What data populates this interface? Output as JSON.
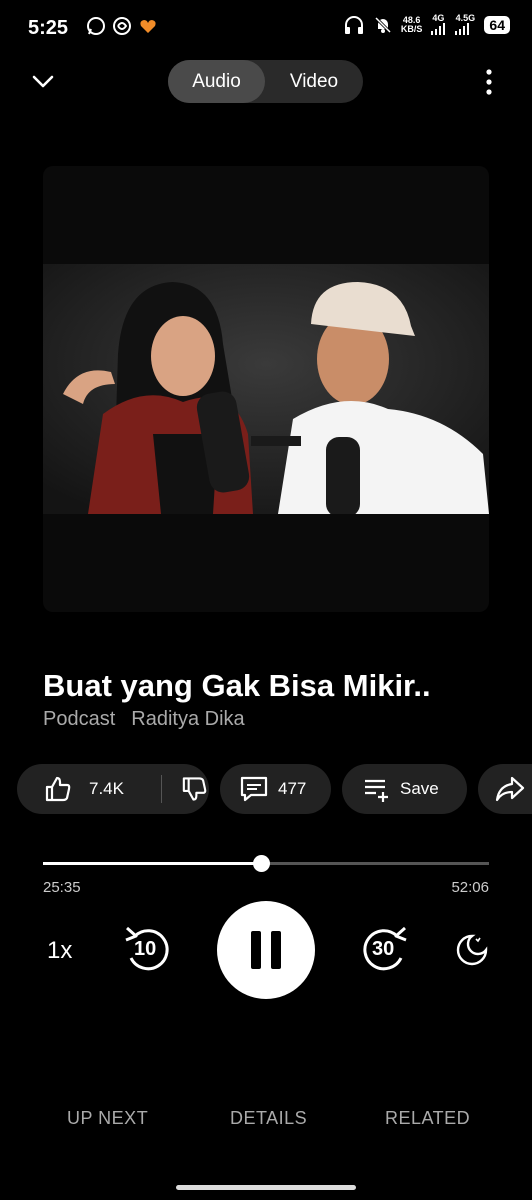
{
  "status": {
    "time": "5:25",
    "net_speed_top": "48.6",
    "net_speed_bottom": "KB/S",
    "net_4g": "4G",
    "net_45g": "4.5G",
    "battery": "64"
  },
  "topbar": {
    "tabs": [
      {
        "label": "Audio",
        "active": true
      },
      {
        "label": "Video",
        "active": false
      }
    ]
  },
  "track": {
    "title": "Buat yang Gak Bisa Mikir..",
    "category": "Podcast",
    "channel": "Raditya Dika"
  },
  "actions": {
    "likes": "7.4K",
    "comments": "477",
    "save_label": "Save"
  },
  "player": {
    "elapsed": "25:35",
    "duration": "52:06",
    "progress": 0.491,
    "speed": "1x",
    "rewind_seconds": "10",
    "forward_seconds": "30"
  },
  "bottom_tabs": [
    "UP NEXT",
    "DETAILS",
    "RELATED"
  ],
  "colors": {
    "background": "#000000",
    "pill": "#222222",
    "accent": "#ffffff"
  }
}
